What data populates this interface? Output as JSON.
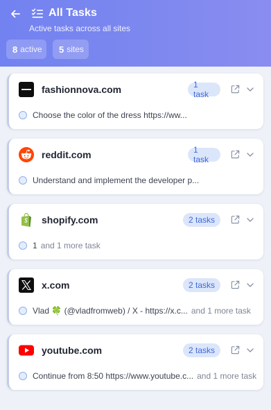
{
  "header": {
    "title": "All Tasks",
    "subtitle": "Active tasks across all sites",
    "stats": [
      {
        "value": "8",
        "label": "active"
      },
      {
        "value": "5",
        "label": "sites"
      }
    ]
  },
  "sites": [
    {
      "name": "fashionnova.com",
      "badge": "1 task",
      "task": "Choose the color of the dress https://ww...",
      "more": "",
      "icon": "fashionnova-logo-icon"
    },
    {
      "name": "reddit.com",
      "badge": "1 task",
      "task": "Understand and implement the developer p...",
      "more": "",
      "icon": "reddit-logo-icon"
    },
    {
      "name": "shopify.com",
      "badge": "2 tasks",
      "task": "1",
      "more": "and 1 more task",
      "icon": "shopify-logo-icon"
    },
    {
      "name": "x.com",
      "badge": "2 tasks",
      "task": "Vlad 🍀 (@vladfromweb) / X - https://x.c...",
      "more": "and 1 more task",
      "icon": "x-logo-icon"
    },
    {
      "name": "youtube.com",
      "badge": "2 tasks",
      "task": "Continue from 8:50 https://www.youtube.c...",
      "more": "and 1 more task",
      "icon": "youtube-logo-icon"
    }
  ],
  "colors": {
    "header_start": "#7282f0",
    "header_end": "#8a8cf0",
    "badge_bg": "#dbe6fb",
    "badge_text": "#3f68d8",
    "page_bg": "#eef1f7"
  }
}
